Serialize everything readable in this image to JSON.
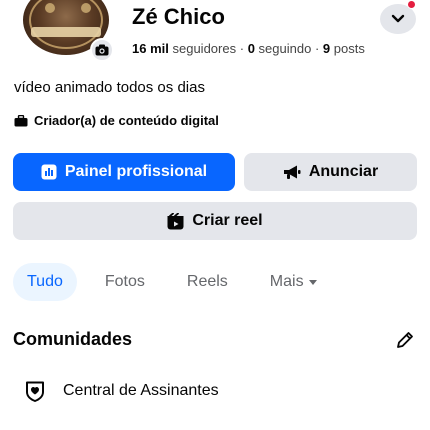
{
  "profile": {
    "name": "Zé Chico",
    "followers_count": "16 mil",
    "followers_label": "seguidores",
    "following_count": "0",
    "following_label": "seguindo",
    "posts_count": "9",
    "posts_label": "posts",
    "separator": "·",
    "bio": "vídeo animado todos os dias",
    "category": "Criador(a) de conteúdo digital"
  },
  "actions": {
    "professional_dashboard": "Painel profissional",
    "advertise": "Anunciar",
    "create_reel": "Criar reel"
  },
  "tabs": [
    {
      "label": "Tudo",
      "active": true
    },
    {
      "label": "Fotos",
      "active": false
    },
    {
      "label": "Reels",
      "active": false
    },
    {
      "label": "Mais",
      "active": false
    }
  ],
  "communities": {
    "title": "Comunidades",
    "items": [
      {
        "label": "Central de Assinantes"
      }
    ]
  },
  "colors": {
    "primary": "#0866ff",
    "secondary_button": "#e4e6eb",
    "notification": "#e41e3f",
    "active_tab_bg": "#ebf5ff"
  }
}
